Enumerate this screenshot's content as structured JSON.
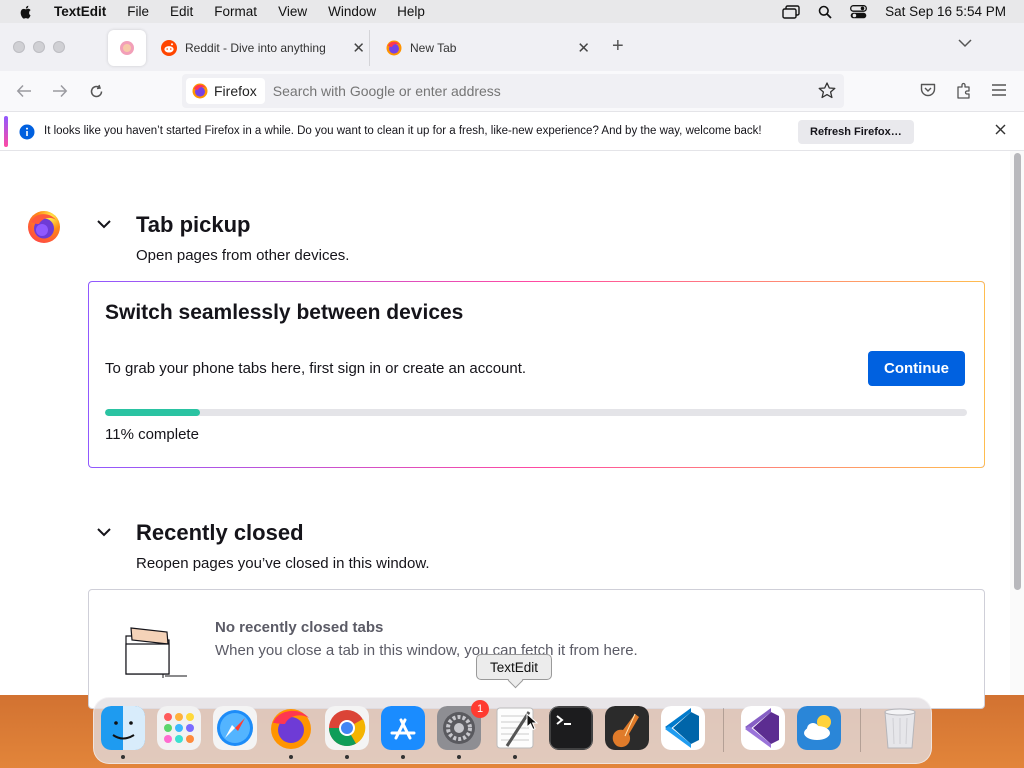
{
  "menubar": {
    "app_name": "TextEdit",
    "menus": [
      "File",
      "Edit",
      "Format",
      "View",
      "Window",
      "Help"
    ],
    "datetime": "Sat Sep 16  5:54 PM"
  },
  "tabs": {
    "pinned_icon": "firefox-view-icon",
    "items": [
      {
        "title": "Reddit - Dive into anything",
        "icon": "reddit-icon"
      },
      {
        "title": "New Tab",
        "icon": "firefox-icon"
      }
    ]
  },
  "urlbar": {
    "identity_label": "Firefox",
    "placeholder": "Search with Google or enter address"
  },
  "infobar": {
    "message": "It looks like you haven’t started Firefox in a while. Do you want to clean it up for a fresh, like-new experience? And by the way, welcome back!",
    "button_label": "Refresh Firefox…"
  },
  "tab_pickup": {
    "title": "Tab pickup",
    "subtitle": "Open pages from other devices.",
    "card_title": "Switch seamlessly between devices",
    "card_text": "To grab your phone tabs here, first sign in or create an account.",
    "continue_label": "Continue",
    "progress_percent": 11,
    "progress_label": "11% complete"
  },
  "recently_closed": {
    "title": "Recently closed",
    "subtitle": "Reopen pages you’ve closed in this window.",
    "empty_title": "No recently closed tabs",
    "empty_text": "When you close a tab in this window, you can fetch it from here."
  },
  "tooltip": {
    "label": "TextEdit"
  },
  "dock": {
    "items": [
      {
        "name": "Finder",
        "icon": "finder-icon",
        "running": true
      },
      {
        "name": "Launchpad",
        "icon": "launchpad-icon",
        "running": false
      },
      {
        "name": "Safari",
        "icon": "safari-icon",
        "running": false
      },
      {
        "name": "Firefox",
        "icon": "firefox-icon",
        "running": true
      },
      {
        "name": "Chrome",
        "icon": "chrome-icon",
        "running": true
      },
      {
        "name": "App Store",
        "icon": "app-store-icon",
        "running": true
      },
      {
        "name": "System Settings",
        "icon": "settings-icon",
        "running": true,
        "badge": "1"
      },
      {
        "name": "TextEdit",
        "icon": "textedit-icon",
        "running": true
      },
      {
        "name": "Terminal",
        "icon": "terminal-icon",
        "running": false
      },
      {
        "name": "GarageBand",
        "icon": "garageband-icon",
        "running": false
      },
      {
        "name": "Visual Studio Code",
        "icon": "vscode-icon",
        "running": false
      },
      {
        "name": "Visual Studio",
        "icon": "visual-studio-icon",
        "running": false
      },
      {
        "name": "Weather",
        "icon": "weather-icon",
        "running": false
      },
      {
        "name": "Trash",
        "icon": "trash-icon",
        "running": false
      }
    ]
  },
  "colors": {
    "accent_blue": "#0061e0",
    "progress_green": "#2ac3a2"
  }
}
